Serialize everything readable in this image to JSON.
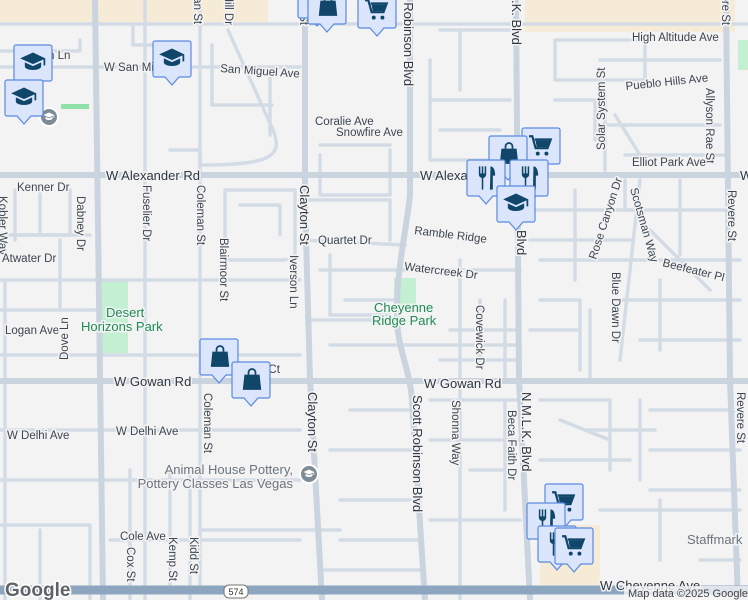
{
  "map": {
    "streets": {
      "w_alexander_rd": "W Alexander Rd",
      "w_alexander_rd_partial": "W Alexa",
      "w_gowan_rd": "W Gowan Rd",
      "w_cheyenne_ave": "W Cheyenne Ave",
      "w_san_miguel_ave": "W San Mi",
      "san_miguel_ave": "San Miguel Ave",
      "coralie_ave": "Coralie Ave",
      "snowfire_ave": "Snowfire Ave",
      "high_altitude_ave": "High Altitude Ave",
      "pueblo_hills_ave": "Pueblo Hills Ave",
      "allyson_rae_st": "Allyson Rae St",
      "solar_system_st": "Solar System St",
      "elliot_park_ave": "Elliot Park Ave",
      "rose_canyon_dr": "Rose Canyon Dr",
      "scotsman_way": "Scotsman Way",
      "beefeater_pl": "Beefeater Pl",
      "blue_dawn_dr": "Blue Dawn Dr",
      "revere_st": "Revere St",
      "kenner_dr": "Kenner Dr",
      "dabney_dr": "Dabney Dr",
      "kobler_way": "Kobler Way",
      "atwater_dr": "Atwater Dr",
      "fuselier_dr": "Fuselier Dr",
      "coleman_st": "Coleman St",
      "blairmoor_st": "Blairmoor St",
      "iverson_ln": "Iverson Ln",
      "clayton_st": "Clayton St",
      "quartet_dr": "Quartet Dr",
      "ramble_ridge": "Ramble Ridge",
      "watercreek_dr": "Watercreek Dr",
      "logan_ave": "Logan Ave",
      "dove_ln": "Dove Ln",
      "er_ct": "er Ct",
      "w_delhi_ave": "W Delhi Ave",
      "cole_ave": "Cole Ave",
      "cox_st": "Cox St",
      "kemp_st": "Kemp St",
      "kidd_st": "Kidd St",
      "scott_robinson_blvd": "Scott Robinson Blvd",
      "scott_robinson_blvd_top": "t Robinson Blvd",
      "shonna_way": "Shonna Way",
      "beca_faith_dr": "Beca Faith Dr",
      "covewick_dr": "Covewick Dr",
      "n_mlk_blvd": "N M.L.K. Blvd",
      "mlk_top": ".K. Blvd",
      "mlk_mid": "Blvd",
      "hill_dr": "l Hill Dr",
      "ln_partial": "n Ln",
      "highway_shield": "574"
    },
    "parks": {
      "desert_horizons_1": "Desert",
      "desert_horizons_2": "Horizons Park",
      "cheyenne_ridge_1": "Cheyenne",
      "cheyenne_ridge_2": "Ridge Park"
    },
    "poi": {
      "animal_house_1": "Animal House Pottery,",
      "animal_house_2": "Pottery Classes Las Vegas",
      "staffmark": "Staffmark"
    },
    "attribution": "Map data ©2025 Google",
    "logo": "Google",
    "colors": {
      "marker_fill": "#dbe5fb",
      "marker_border": "#5a8ae0",
      "marker_icon": "#0f4669",
      "park": "#c3efd2",
      "commercial": "#f5ebd6"
    },
    "markers": [
      "school",
      "school",
      "school",
      "school",
      "shopping-bag",
      "shopping-bag",
      "cart",
      "cart",
      "cart",
      "cart",
      "cart",
      "restaurant",
      "restaurant",
      "restaurant"
    ]
  }
}
